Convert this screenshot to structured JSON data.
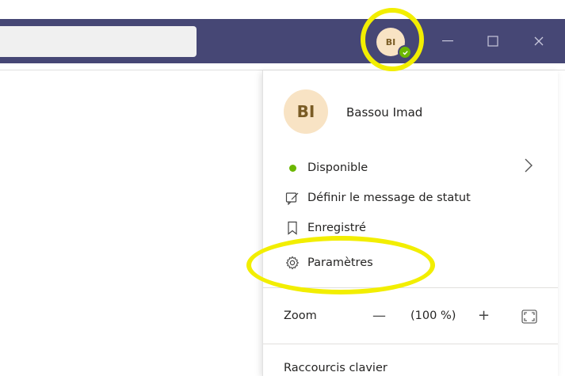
{
  "titlebar": {
    "avatar_initials": "BI",
    "window_controls": [
      "minimize",
      "maximize",
      "close"
    ]
  },
  "menu": {
    "profile": {
      "initials": "BI",
      "name": "Bassou Imad"
    },
    "status": {
      "label": "Disponible",
      "color": "#6bb700"
    },
    "set_status_message": "Définir le message de statut",
    "saved": "Enregistré",
    "settings": "Paramètres",
    "zoom": {
      "label": "Zoom",
      "value": "(100 %)"
    },
    "keyboard_shortcuts": "Raccourcis clavier"
  },
  "colors": {
    "titlebar": "#464775",
    "highlight": "#f2ee00",
    "avatar_bg": "#f8e3c4",
    "avatar_text": "#7a5c25"
  }
}
